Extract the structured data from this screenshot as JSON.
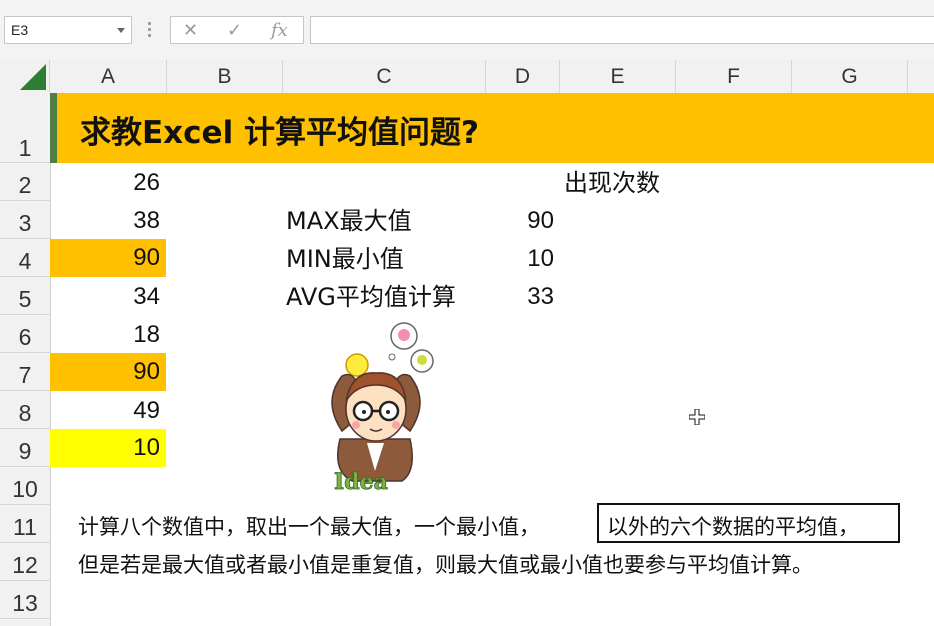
{
  "formula_bar": {
    "name_box": "E3",
    "cancel_glyph": "✕",
    "enter_glyph": "✓",
    "fx_glyph": "fx",
    "formula_value": ""
  },
  "columns": [
    "A",
    "B",
    "C",
    "D",
    "E",
    "F",
    "G"
  ],
  "rows": [
    "1",
    "2",
    "3",
    "4",
    "5",
    "6",
    "7",
    "8",
    "9",
    "10",
    "11",
    "12",
    "13"
  ],
  "sheet": {
    "title": "求教Excel 计算平均值问题?",
    "col_a_values": [
      "26",
      "38",
      "90",
      "34",
      "18",
      "90",
      "49",
      "10"
    ],
    "col_a_highlight": [
      "none",
      "none",
      "orange",
      "none",
      "none",
      "orange",
      "none",
      "yellow"
    ],
    "e2_label": "出现次数",
    "stats": [
      {
        "label": "MAX最大值",
        "value": "90"
      },
      {
        "label": "MIN最小值",
        "value": "10"
      },
      {
        "label": "AVG平均值计算",
        "value": "33"
      }
    ],
    "note_line1_a": "计算八个数值中，取出一个最大值，一个最小值，",
    "note_line1_b": "以外的六个数据的平均值，",
    "note_line2": "但是若是最大值或者最小值是重复值，则最大值或最小值也要参与平均值计算。",
    "picture_text": "Idea"
  },
  "colors": {
    "title_fill": "#ffc000",
    "highlight_orange": "#ffc000",
    "highlight_yellow": "#ffff00",
    "corner_green": "#2e7d32"
  }
}
